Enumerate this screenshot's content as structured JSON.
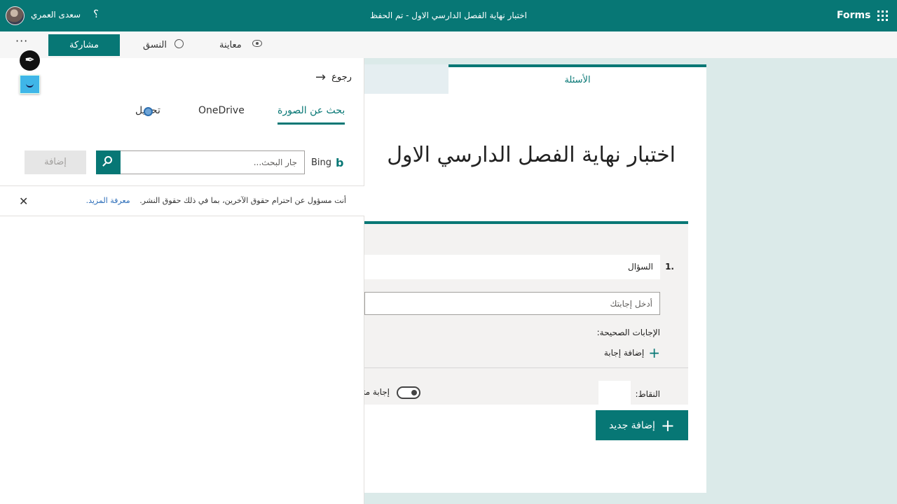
{
  "topbar": {
    "user_name": "سعدى العمري",
    "help_glyph": "؟",
    "document_title": "اختبار نهاية الفصل الدارسي الاول - تم الحفظ",
    "brand": "Forms"
  },
  "commandbar": {
    "more_glyph": "···",
    "share_label": "مشاركة",
    "theme_label": "النسق",
    "preview_label": "معاينة"
  },
  "image_panel": {
    "back_label": "رجوع",
    "tabs": {
      "search": "بحث عن الصورة",
      "onedrive": "OneDrive",
      "upload": "تحميل"
    },
    "bing_label": "Bing",
    "search_placeholder": "جار البحث...",
    "add_label": "إضافة",
    "notice_text": "أنت مسؤول عن احترام حقوق الآخرين، بما في ذلك حقوق النشر.",
    "notice_link": "معرفة المزيد.",
    "close_glyph": "✕"
  },
  "form": {
    "tab_questions": "الأسئلة",
    "title": "اختبار نهاية الفصل الدارسي الاول",
    "question": {
      "number": "1.",
      "text": "السؤال",
      "answer_placeholder": "أدخل إجابتك",
      "correct_answers_label": "الإجابات الصحيحة:",
      "add_answer_label": "إضافة إجابة",
      "points_label": "النقاط:",
      "multi_answer_label": "إجابة متعددة"
    },
    "add_new_label": "إضافة جديد"
  },
  "overlay": {
    "pen_glyph": "✒"
  },
  "colors": {
    "accent": "#077775",
    "background": "#dbeae9",
    "link": "#2a6cb8"
  }
}
